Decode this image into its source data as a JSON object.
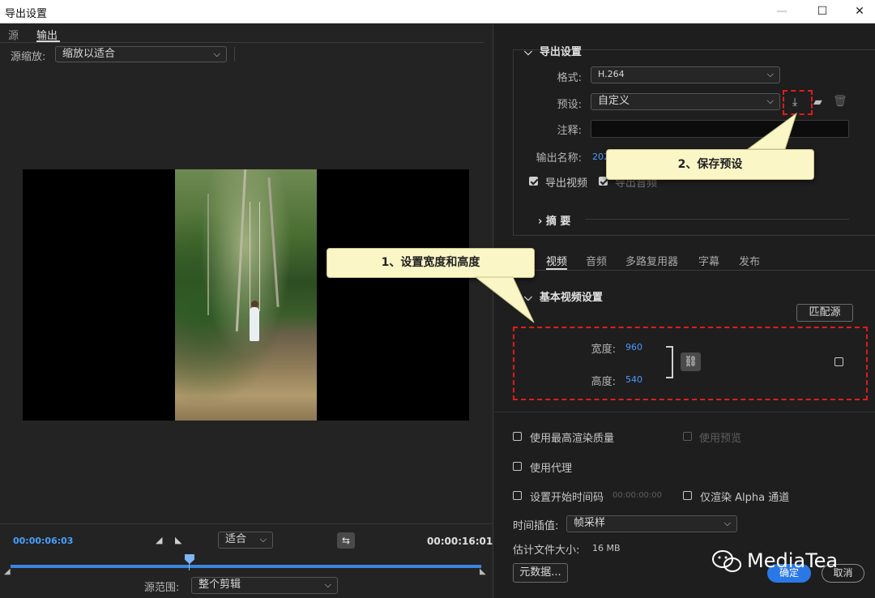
{
  "window": {
    "title": "导出设置",
    "min": "—",
    "max": "☐",
    "close": "✕"
  },
  "left": {
    "tabs": [
      "源",
      "输出"
    ],
    "source_scale_label": "源缩放:",
    "source_scale_value": "缩放以适合",
    "timecode_current": "00:00:06:03",
    "timecode_end": "00:00:16:01",
    "zoom_value": "适合",
    "source_range_label": "源范围:",
    "source_range_value": "整个剪辑"
  },
  "callouts": {
    "step1": "1、设置宽度和高度",
    "step2": "2、保存预设"
  },
  "export_settings": {
    "section_title": "导出设置",
    "format_label": "格式:",
    "format_value": "H.264",
    "preset_label": "预设:",
    "preset_value": "自定义",
    "comments_label": "注释:",
    "output_name_label": "输出名称:",
    "output_name_value": "202",
    "export_video_label": "导出视频",
    "export_audio_label": "导出音频",
    "summary_label": "摘 要"
  },
  "tabs_right": [
    "视频",
    "音频",
    "多路复用器",
    "字幕",
    "发布"
  ],
  "video": {
    "basic_settings_title": "基本视频设置",
    "match_source_button": "匹配源",
    "width_label": "宽度:",
    "width_value": "960",
    "height_label": "高度:",
    "height_value": "540"
  },
  "options": {
    "max_render_quality": "使用最高渲染质量",
    "use_previews": "使用预览",
    "use_proxies": "使用代理",
    "set_start_timecode": "设置开始时间码",
    "start_timecode_value": "00:00:00:00",
    "render_alpha_only": "仅渲染 Alpha 通道",
    "time_interpolation_label": "时间插值:",
    "time_interpolation_value": "帧采样",
    "estimated_size_label": "估计文件大小:",
    "estimated_size_value": "16 MB",
    "metadata_button": "元数据...",
    "ok_button": "确定",
    "cancel_button": "取消"
  },
  "watermark": "MediaTea",
  "colors": {
    "accent_blue": "#2a78e6",
    "timecode_blue": "#4aa0ff",
    "annotation_red": "#e01b1b",
    "callout_bg": "#fbf6c6"
  }
}
